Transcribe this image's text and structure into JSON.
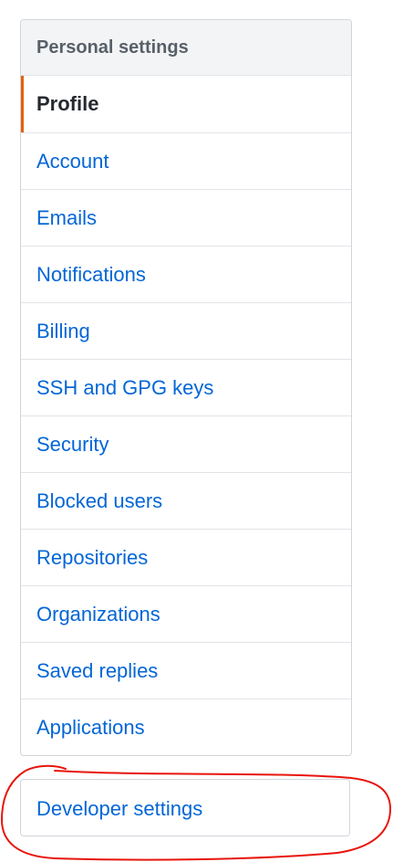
{
  "menu": {
    "heading": "Personal settings",
    "items": [
      {
        "label": "Profile",
        "selected": true
      },
      {
        "label": "Account"
      },
      {
        "label": "Emails"
      },
      {
        "label": "Notifications"
      },
      {
        "label": "Billing"
      },
      {
        "label": "SSH and GPG keys"
      },
      {
        "label": "Security"
      },
      {
        "label": "Blocked users"
      },
      {
        "label": "Repositories"
      },
      {
        "label": "Organizations"
      },
      {
        "label": "Saved replies"
      },
      {
        "label": "Applications"
      }
    ]
  },
  "developer": {
    "label": "Developer settings"
  },
  "colors": {
    "link": "#0366d6",
    "selected_accent": "#e36209",
    "annotation": "#e8140c"
  }
}
